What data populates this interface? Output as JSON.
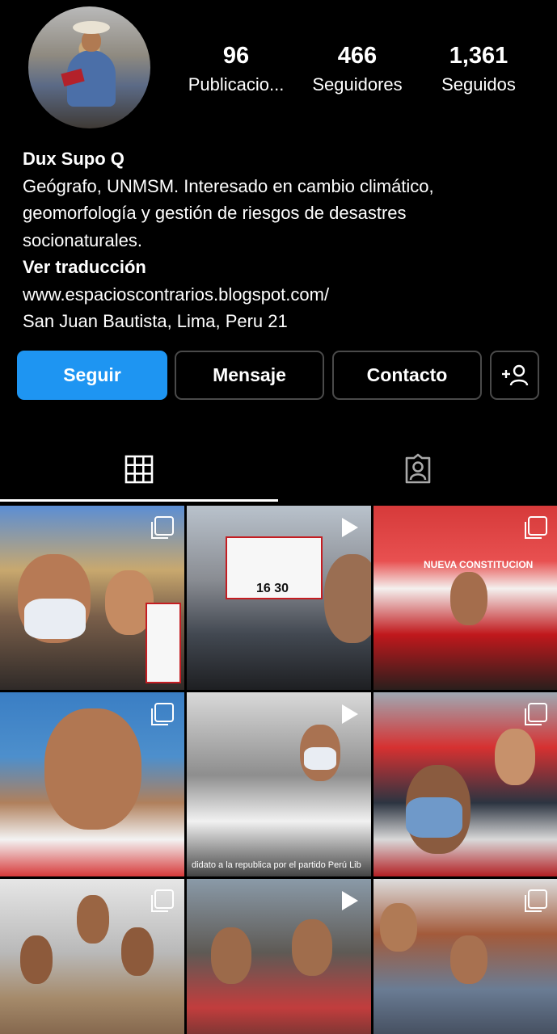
{
  "profile": {
    "name": "Dux Supo Q",
    "bio_lines": [
      "Geógrafo, UNMSM. Interesado en cambio climático,",
      "geomorfología y gestión de riesgos de desastres",
      "socionaturales."
    ],
    "translate_label": "Ver traducción",
    "link": "www.espacioscontrarios.blogspot.com/",
    "location": "San Juan Bautista, Lima, Peru 21"
  },
  "stats": {
    "posts": {
      "value": "96",
      "label": "Publicacio..."
    },
    "followers": {
      "value": "466",
      "label": "Seguidores"
    },
    "following": {
      "value": "1,361",
      "label": "Seguidos"
    }
  },
  "buttons": {
    "follow": "Seguir",
    "message": "Mensaje",
    "contact": "Contacto",
    "add_user_icon": "add-person-icon"
  },
  "tabs": [
    {
      "icon": "grid-icon",
      "active": true
    },
    {
      "icon": "tagged-person-icon",
      "active": false
    }
  ],
  "grid_posts": [
    {
      "type": "multi",
      "icon": "carousel-icon"
    },
    {
      "type": "video",
      "icon": "play-icon",
      "caption": "16 30"
    },
    {
      "type": "multi",
      "icon": "carousel-icon",
      "caption": "NUEVA CONSTITUCION"
    },
    {
      "type": "multi",
      "icon": "carousel-icon"
    },
    {
      "type": "video",
      "icon": "play-icon",
      "caption": "didato a la republica por el partido Perú Lib"
    },
    {
      "type": "multi",
      "icon": "carousel-icon"
    },
    {
      "type": "multi",
      "icon": "carousel-icon"
    },
    {
      "type": "video",
      "icon": "play-icon"
    },
    {
      "type": "multi",
      "icon": "carousel-icon"
    }
  ],
  "colors": {
    "background": "#000000",
    "primary_button": "#1e95f2",
    "button_border": "#4a4a4a"
  }
}
